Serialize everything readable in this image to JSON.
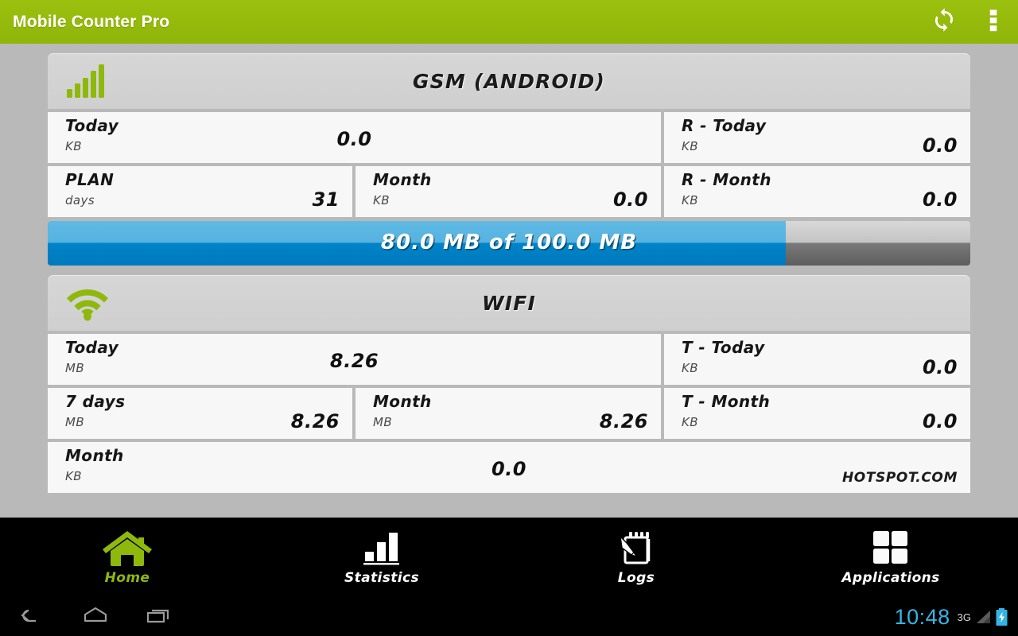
{
  "actionbar": {
    "title": "Mobile Counter Pro",
    "refresh_icon": "sync-refresh-icon",
    "overflow_icon": "overflow-menu-icon",
    "background_color": "#9cc00e"
  },
  "gsm_card": {
    "icon": "signal-bars-icon",
    "title": "GSM (ANDROID)",
    "rows": [
      {
        "label": "Today",
        "unit": "KB",
        "value": "0.0"
      },
      {
        "label": "R - Today",
        "unit": "KB",
        "value": "0.0"
      },
      {
        "label": "PLAN",
        "unit": "days",
        "value": "31"
      },
      {
        "label": "Month",
        "unit": "KB",
        "value": "0.0"
      },
      {
        "label": "R - Month",
        "unit": "KB",
        "value": "0.0"
      }
    ]
  },
  "plan_progress": {
    "text": "80.0 MB of 100.0 MB",
    "used": 80.0,
    "limit": 100.0,
    "unit": "MB",
    "percent": 80,
    "fill_color": "#0084c8"
  },
  "wifi_card": {
    "icon": "wifi-icon",
    "title": "WIFI",
    "rows": [
      {
        "label": "Today",
        "unit": "MB",
        "value": "8.26"
      },
      {
        "label": "T - Today",
        "unit": "KB",
        "value": "0.0"
      },
      {
        "label": "7 days",
        "unit": "MB",
        "value": "8.26"
      },
      {
        "label": "Month",
        "unit": "MB",
        "value": "8.26"
      },
      {
        "label": "T - Month",
        "unit": "KB",
        "value": "0.0"
      },
      {
        "label": "Month",
        "unit": "KB",
        "value": "0.0",
        "note": "HOTSPOT.COM"
      }
    ]
  },
  "app_nav": {
    "items": [
      {
        "label": "Home",
        "icon": "home-icon",
        "active": true
      },
      {
        "label": "Statistics",
        "icon": "bar-chart-icon",
        "active": false
      },
      {
        "label": "Logs",
        "icon": "notepad-pencil-icon",
        "active": false
      },
      {
        "label": "Applications",
        "icon": "grid-squares-icon",
        "active": false
      }
    ],
    "active_color": "#8fb80c"
  },
  "system_bar": {
    "back_icon": "back-icon",
    "home_icon": "home-outline-icon",
    "recents_icon": "recents-icon",
    "clock": "10:48",
    "network_type": "3G",
    "signal_icon": "signal-triangle-icon",
    "battery_icon": "battery-charging-icon",
    "clock_color": "#33b5e5"
  }
}
